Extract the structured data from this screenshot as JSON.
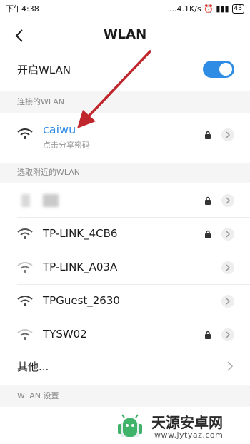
{
  "status_bar": {
    "time": "下午4:38",
    "right_text": "...4.1K/s ⏰ ▮▮▮",
    "battery": "43"
  },
  "header": {
    "title": "WLAN"
  },
  "wlan_toggle": {
    "label": "开启WLAN",
    "state": "on",
    "accent_color": "#2f8ce4"
  },
  "connected_section": {
    "header": "连接的WLAN",
    "network": {
      "ssid": "caiwu",
      "subtitle": "点击分享密码",
      "ssid_color": "#2f8ce4",
      "locked": true
    }
  },
  "nearby_section": {
    "header": "选取附近的WLAN",
    "networks": [
      {
        "ssid": "",
        "locked": true,
        "blurred": true
      },
      {
        "ssid": "TP-LINK_4CB6",
        "locked": true
      },
      {
        "ssid": "TP-LINK_A03A",
        "locked": false
      },
      {
        "ssid": "TPGuest_2630",
        "locked": false
      },
      {
        "ssid": "TYSW02",
        "locked": true
      }
    ],
    "other_label": "其他..."
  },
  "settings_section": {
    "header": "WLAN 设置"
  },
  "annotation": {
    "arrow_color": "#c0272d"
  },
  "watermark": {
    "title": "天源安卓网",
    "url": "www.jytyaz.com"
  }
}
